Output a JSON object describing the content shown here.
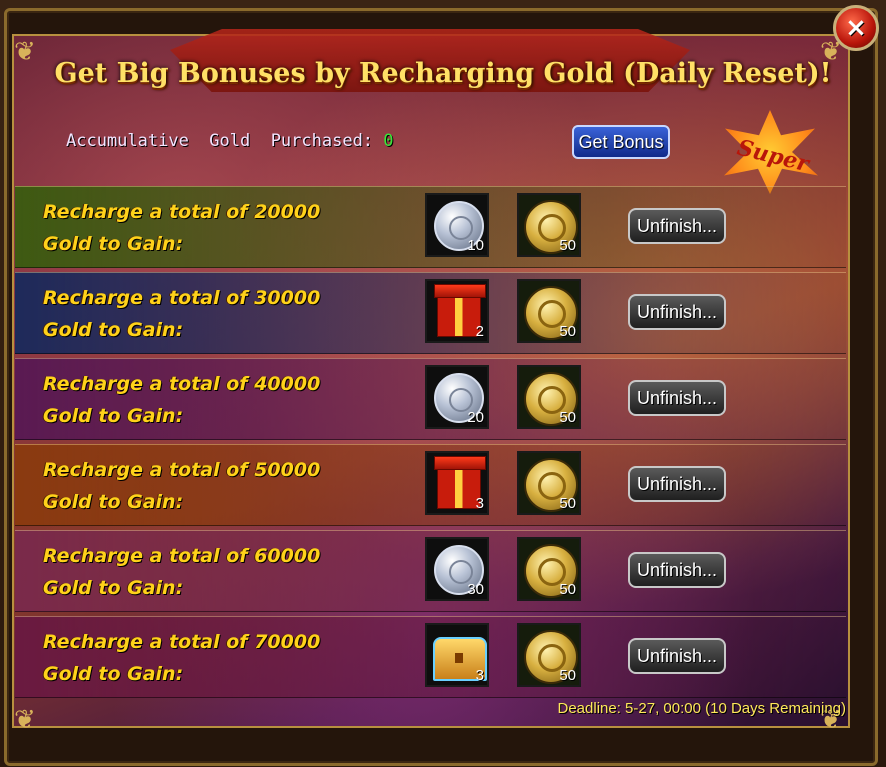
{
  "dialog": {
    "title": "Get Big Bonuses by Recharging Gold (Daily Reset)!",
    "close_icon": "×",
    "accumulative_label": "Accumulative  Gold  Purchased: ",
    "accumulative_value": "0",
    "get_bonus_label": "Get Bonus",
    "super_badge": "Super",
    "deadline": "Deadline: 5-27, 00:00 (10 Days Remaining)"
  },
  "rows": [
    {
      "line1": "Recharge a total of 20000",
      "line2": "Gold to Gain:",
      "item1_icon": "silver-coin-icon",
      "item1_qty": "10",
      "item2_icon": "gold-medal-icon",
      "item2_qty": "50",
      "button": "Unfinish...",
      "bg": "#3e5a12"
    },
    {
      "line1": "Recharge a total of 30000",
      "line2": "Gold to Gain:",
      "item1_icon": "gift-box-icon",
      "item1_qty": "2",
      "item2_icon": "gold-medal-icon",
      "item2_qty": "50",
      "button": "Unfinish...",
      "bg": "#1e2a5a"
    },
    {
      "line1": "Recharge a total of 40000",
      "line2": "Gold to Gain:",
      "item1_icon": "silver-coin-icon",
      "item1_qty": "20",
      "item2_icon": "gold-medal-icon",
      "item2_qty": "50",
      "button": "Unfinish...",
      "bg": "#5a1a52"
    },
    {
      "line1": "Recharge a total of 50000",
      "line2": "Gold to Gain:",
      "item1_icon": "gift-box-icon",
      "item1_qty": "3",
      "item2_icon": "gold-medal-icon",
      "item2_qty": "50",
      "button": "Unfinish...",
      "bg": "#8a3a10"
    },
    {
      "line1": "Recharge a total of 60000",
      "line2": "Gold to Gain:",
      "item1_icon": "silver-coin-icon",
      "item1_qty": "30",
      "item2_icon": "gold-medal-icon",
      "item2_qty": "50",
      "button": "Unfinish...",
      "bg": "#7a2a4a"
    },
    {
      "line1": "Recharge a total of 70000",
      "line2": "Gold to Gain:",
      "item1_icon": "treasure-chest-icon",
      "item1_qty": "3",
      "item2_icon": "gold-medal-icon",
      "item2_qty": "50",
      "button": "Unfinish...",
      "bg": "#6a1a40"
    }
  ]
}
